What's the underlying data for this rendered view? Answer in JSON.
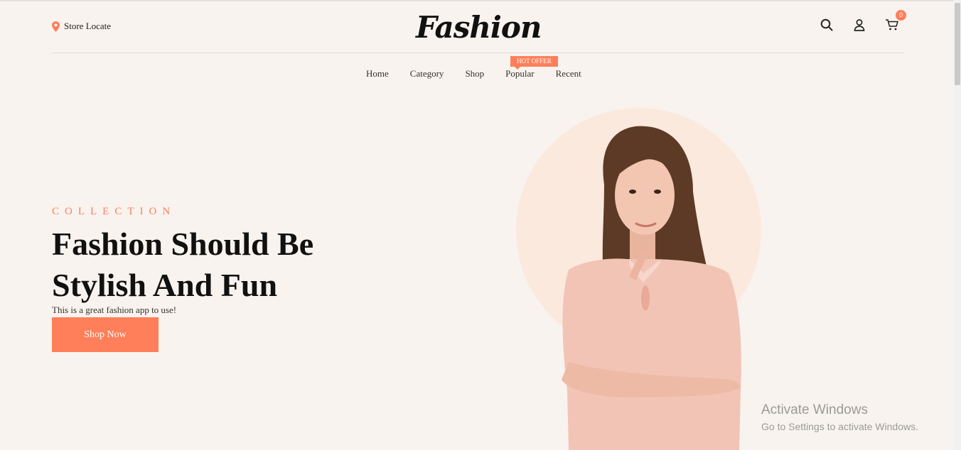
{
  "header": {
    "store_label": "Store Locate",
    "logo_text": "Fashion",
    "cart_count": "0"
  },
  "nav": {
    "items": [
      "Home",
      "Category",
      "Shop",
      "Popular",
      "Recent"
    ],
    "badge": "HOT OFFER"
  },
  "hero": {
    "eyebrow": "COLLECTION",
    "headline_line1": "Fashion Should Be",
    "headline_line2": "Stylish And Fun",
    "tagline": "This is a great fashion app to use!",
    "cta_label": "Shop Now"
  },
  "watermark": {
    "title": "Activate Windows",
    "subtitle": "Go to Settings to activate Windows."
  },
  "colors": {
    "accent": "#ff7f5a",
    "background": "#f8f3ee",
    "circle": "#fbe9dd"
  }
}
